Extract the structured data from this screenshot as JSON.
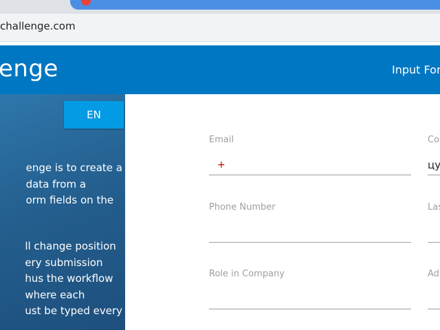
{
  "browser": {
    "url": "challenge.com"
  },
  "header": {
    "logo_text": "enge",
    "nav_item": "Input For"
  },
  "sidebar": {
    "lang_button": "EN",
    "paragraph1": [
      "enge is to create a",
      "data from a",
      "orm fields on the"
    ],
    "paragraph2": [
      "ll change position",
      "ery submission",
      "hus the workflow",
      "where each",
      "ust be typed every"
    ]
  },
  "form": {
    "fields": [
      {
        "label": "Email",
        "value": ""
      },
      {
        "label": "Co",
        "value": "цу"
      },
      {
        "label": "Phone Number",
        "value": ""
      },
      {
        "label": "Las",
        "value": ""
      },
      {
        "label": "Role in Company",
        "value": ""
      },
      {
        "label": "Ad",
        "value": ""
      }
    ]
  },
  "colors": {
    "header_bg": "#0077c2",
    "lang_button_bg": "#049be5",
    "sidebar_bg": "#245f8f"
  }
}
